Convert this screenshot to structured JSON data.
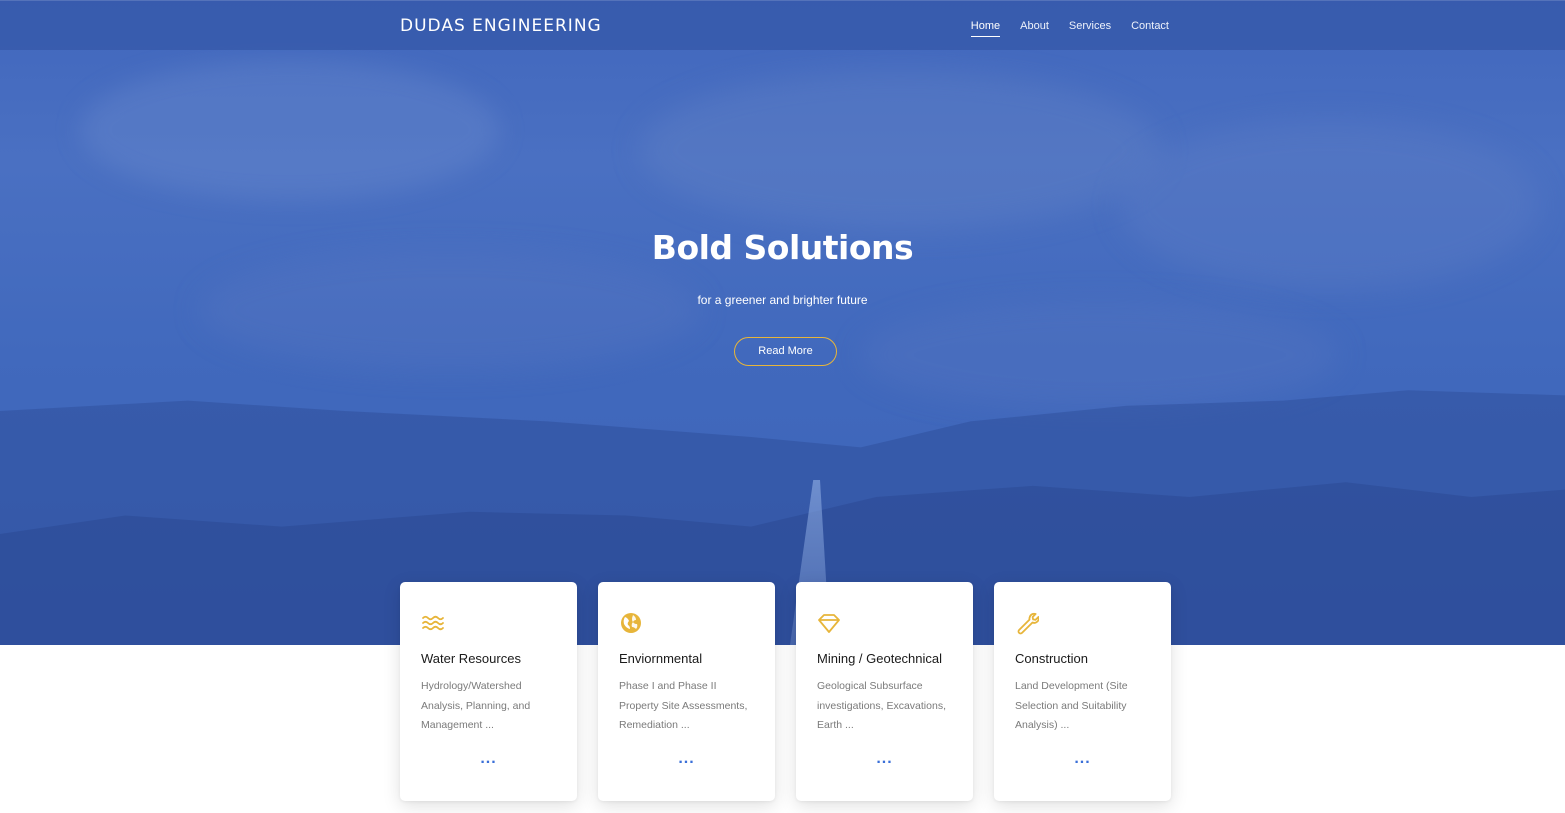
{
  "brand": "DUDAS ENGINEERING",
  "nav": {
    "items": [
      {
        "label": "Home",
        "active": true
      },
      {
        "label": "About",
        "active": false
      },
      {
        "label": "Services",
        "active": false
      },
      {
        "label": "Contact",
        "active": false
      }
    ]
  },
  "hero": {
    "title": "Bold Solutions",
    "subtitle": "for a greener and brighter future",
    "button_label": "Read More"
  },
  "services": [
    {
      "icon": "waves-icon",
      "title": "Water Resources",
      "description": "Hydrology/Watershed Analysis, Planning, and Management ...",
      "more": "..."
    },
    {
      "icon": "globe-icon",
      "title": "Enviornmental",
      "description": "Phase I and Phase II Property Site Assessments, Remediation ...",
      "more": "..."
    },
    {
      "icon": "diamond-icon",
      "title": "Mining / Geotechnical",
      "description": "Geological Subsurface investigations, Excavations, Earth ...",
      "more": "..."
    },
    {
      "icon": "wrench-icon",
      "title": "Construction",
      "description": "Land Development (Site Selection and Suitability Analysis) ...",
      "more": "..."
    }
  ],
  "colors": {
    "primary": "#4169bd",
    "accent": "#e7b53a",
    "link": "#3a6fd8"
  }
}
